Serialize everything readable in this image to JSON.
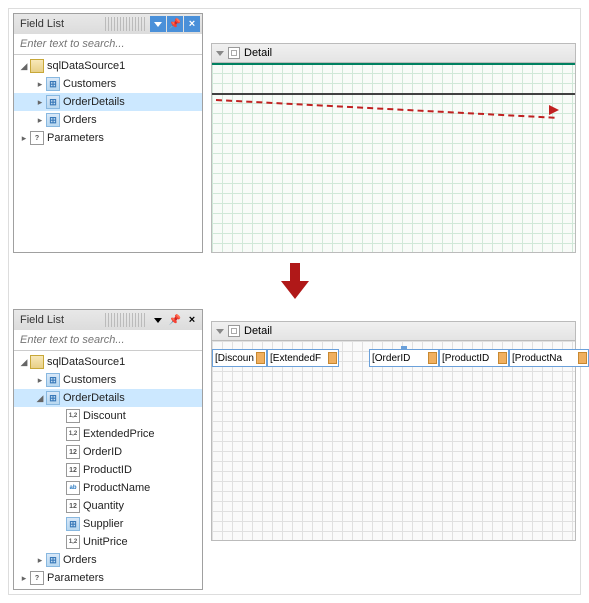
{
  "panel1": {
    "title": "Field List",
    "search_placeholder": "Enter text to search...",
    "tree": {
      "root": "sqlDataSource1",
      "tables": [
        "Customers",
        "OrderDetails",
        "Orders"
      ],
      "params": "Parameters",
      "selected": "OrderDetails"
    }
  },
  "design1": {
    "band": "Detail"
  },
  "panel2": {
    "title": "Field List",
    "search_placeholder": "Enter text to search...",
    "tree": {
      "root": "sqlDataSource1",
      "t0": "Customers",
      "t1": "OrderDetails",
      "fields": [
        {
          "name": "Discount",
          "kind": "dec"
        },
        {
          "name": "ExtendedPrice",
          "kind": "dec"
        },
        {
          "name": "OrderID",
          "kind": "int"
        },
        {
          "name": "ProductID",
          "kind": "int"
        },
        {
          "name": "ProductName",
          "kind": "str"
        },
        {
          "name": "Quantity",
          "kind": "int"
        },
        {
          "name": "Supplier",
          "kind": "tbl"
        },
        {
          "name": "UnitPrice",
          "kind": "dec"
        }
      ],
      "t2": "Orders",
      "params": "Parameters",
      "selected": "OrderDetails"
    }
  },
  "design2": {
    "band": "Detail",
    "cells": [
      "[Discoun",
      "[ExtendedF",
      "[OrderID",
      "[ProductID",
      "[ProductNa"
    ]
  }
}
